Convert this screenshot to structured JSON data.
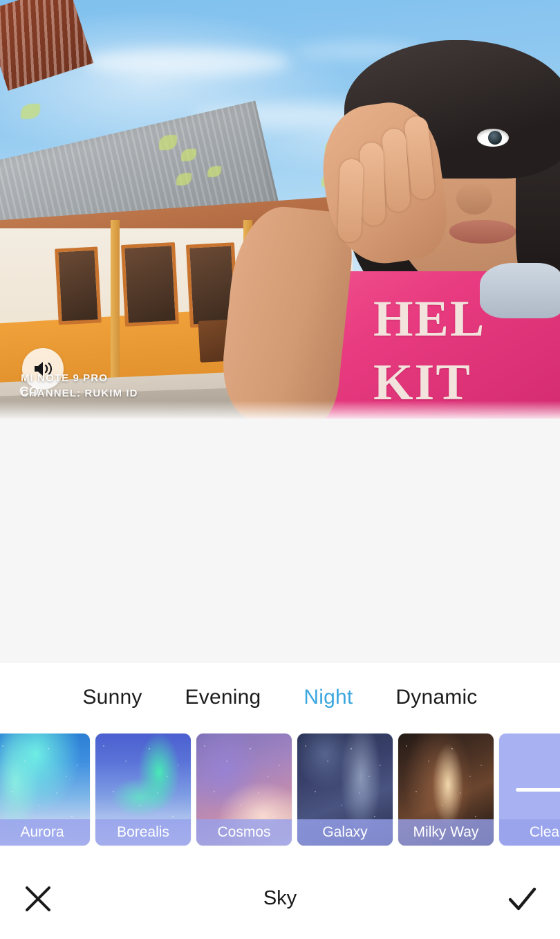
{
  "app": {
    "editor_title": "Sky"
  },
  "preview": {
    "watermark_line1": "MI NOTE 9 PRO",
    "watermark_line2": "CHANNEL: RUKIM ID",
    "watermark_logo": "CO",
    "audio_icon": "speaker-icon",
    "shirt_text_line1": "HEL",
    "shirt_text_line2": "KIT"
  },
  "tabs": {
    "items": [
      {
        "label": "Sunny",
        "active": false
      },
      {
        "label": "Evening",
        "active": false
      },
      {
        "label": "Night",
        "active": true
      },
      {
        "label": "Dynamic",
        "active": false
      }
    ],
    "active_label": "Night",
    "active_color": "#3ba7de",
    "inactive_color": "#1c1c1c"
  },
  "presets": {
    "items": [
      {
        "label": "Aurora",
        "style": "sky-aurora"
      },
      {
        "label": "Borealis",
        "style": "sky-borealis"
      },
      {
        "label": "Cosmos",
        "style": "sky-cosmos"
      },
      {
        "label": "Galaxy",
        "style": "sky-galaxy"
      },
      {
        "label": "Milky Way",
        "style": "sky-milkyway"
      },
      {
        "label": "Clear",
        "style": "thumb-plain"
      }
    ],
    "label_bar_color": "#96a0eb",
    "label_text_color": "#ffffff"
  },
  "action_bar": {
    "cancel_icon": "close-icon",
    "title": "Sky",
    "confirm_icon": "check-icon"
  }
}
